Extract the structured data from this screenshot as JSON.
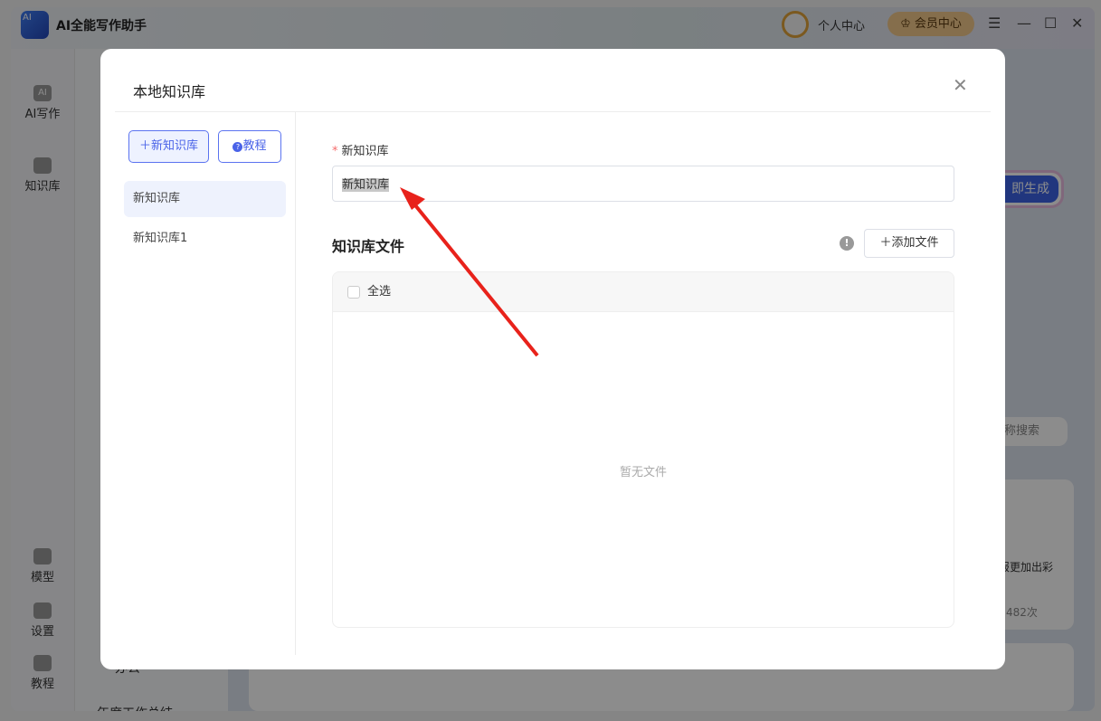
{
  "app": {
    "title": "AI全能写作助手",
    "logo_text": "AI",
    "personal_center": "个人中心",
    "vip_center": "会员中心"
  },
  "sidebar": {
    "items": [
      {
        "label": "AI写作",
        "icon": "AI"
      },
      {
        "label": "知识库",
        "icon": "book-icon"
      },
      {
        "label": "模型",
        "icon": "cloud-download-icon"
      },
      {
        "label": "设置",
        "icon": "gear-icon"
      },
      {
        "label": "教程",
        "icon": "question-icon"
      }
    ]
  },
  "background": {
    "generate_button": "即生成",
    "search_placeholder": "称搜索",
    "card_desc": "报更加出彩",
    "card_count": "482次",
    "office_label": "办公",
    "annual_summary": "年度工作总结"
  },
  "modal": {
    "title": "本地知识库",
    "new_kb_button": "＋新知识库",
    "tutorial_button": "教程",
    "kb_list": [
      {
        "label": "新知识库",
        "selected": true
      },
      {
        "label": "新知识库1",
        "selected": false
      }
    ],
    "name_label": "新知识库",
    "name_value": "新知识库",
    "files_section": "知识库文件",
    "add_file_button": "＋添加文件",
    "select_all": "全选",
    "empty_text": "暂无文件"
  },
  "colors": {
    "accent": "#4a63e8",
    "required": "#f56c6c",
    "arrow": "#e8221b"
  }
}
